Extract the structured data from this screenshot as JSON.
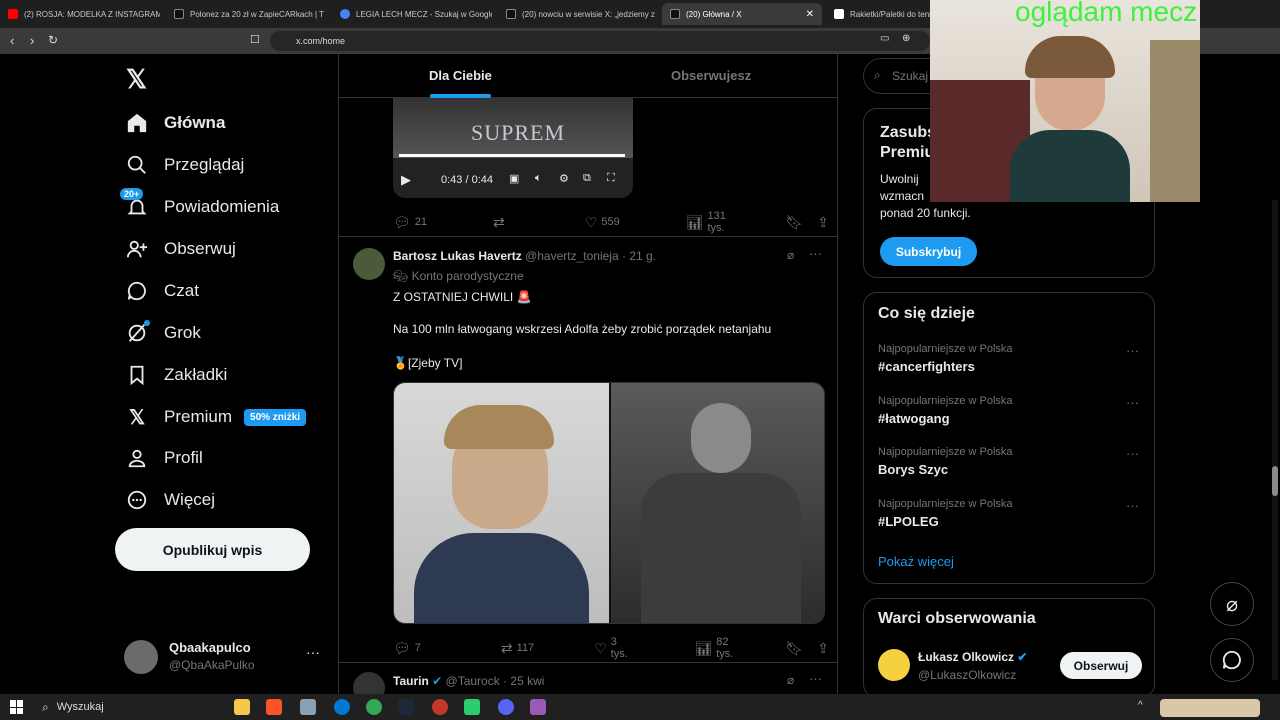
{
  "browser": {
    "tabs": [
      {
        "title": "(2) ROSJA: MODELKA Z INSTAGRAMA",
        "color": "#ff0000"
      },
      {
        "title": "Polonez za 20 zł w ZapieCARkach | T",
        "color": "#111111"
      },
      {
        "title": "LEGIA LECH MECZ - Szukaj w Google",
        "color": "#4285f4"
      },
      {
        "title": "(20) nowciu w serwisie X: „jedziemy z",
        "color": "#111111"
      },
      {
        "title": "(20) Główna / X",
        "color": "#111111"
      },
      {
        "title": "Rakietki/Paletki do tenis",
        "color": "#ffffff"
      }
    ],
    "url": "x.com/home"
  },
  "overlay": {
    "stream_text": "oglądam mecz"
  },
  "sidebar": {
    "items": [
      {
        "label": "Główna",
        "icon": "home-icon"
      },
      {
        "label": "Przeglądaj",
        "icon": "search-icon"
      },
      {
        "label": "Powiadomienia",
        "icon": "bell-icon",
        "badge": "20+"
      },
      {
        "label": "Obserwuj",
        "icon": "follow-icon"
      },
      {
        "label": "Czat",
        "icon": "chat-icon"
      },
      {
        "label": "Grok",
        "icon": "grok-icon"
      },
      {
        "label": "Zakładki",
        "icon": "bookmark-icon"
      },
      {
        "label": "Premium",
        "icon": "x-icon",
        "badge": "50% zniżki"
      },
      {
        "label": "Profil",
        "icon": "profile-icon"
      },
      {
        "label": "Więcej",
        "icon": "more-icon"
      }
    ],
    "publish_label": "Opublikuj wpis",
    "account": {
      "name": "Qbaakapulco",
      "handle": "@QbaAkaPulko"
    }
  },
  "feed": {
    "tabs": [
      "Dla Ciebie",
      "Obserwujesz"
    ],
    "video": {
      "time": "0:43 / 0:44",
      "overlay_text": "SUPREM"
    },
    "first_actions": {
      "replies": "21",
      "likes": "559",
      "views": "131 tys."
    },
    "post": {
      "author": "Bartosz Lukas Havertz",
      "handle": "@havertz_tonieja",
      "time": "21 g.",
      "parody": "Konto parodystyczne",
      "line1": "Z OSTATNIEJ CHWILI 🚨",
      "line2": "Na 100 mln łatwogang wskrzesi Adolfa żeby zrobić porządek netanjahu",
      "line3": "🏅[Zjeby TV]",
      "actions": {
        "replies": "7",
        "reposts": "117",
        "likes": "3 tys.",
        "views": "82 tys."
      }
    },
    "next_post": {
      "author": "Taurin",
      "handle": "@Taurock",
      "time": "25 kwi"
    }
  },
  "right": {
    "search_placeholder": "Szukaj",
    "premium": {
      "title": "Zasubskrybuj Premium",
      "body1": "Uwolnij",
      "body2": "wzmacn",
      "body3": "ponad 20 funkcji.",
      "button": "Subskrybuj"
    },
    "trends_title": "Co się dzieje",
    "trends": [
      {
        "category": "Najpopularniejsze w Polska",
        "name": "#cancerfighters"
      },
      {
        "category": "Najpopularniejsze w Polska",
        "name": "#łatwogang"
      },
      {
        "category": "Najpopularniejsze w Polska",
        "name": "Borys Szyc"
      },
      {
        "category": "Najpopularniejsze w Polska",
        "name": "#LPOLEG"
      }
    ],
    "show_more": "Pokaż więcej",
    "who_title": "Warci obserwowania",
    "who": {
      "name": "Łukasz Olkowicz",
      "handle": "@LukaszOlkowicz",
      "button": "Obserwuj"
    }
  },
  "taskbar": {
    "search": "Wyszukaj"
  }
}
